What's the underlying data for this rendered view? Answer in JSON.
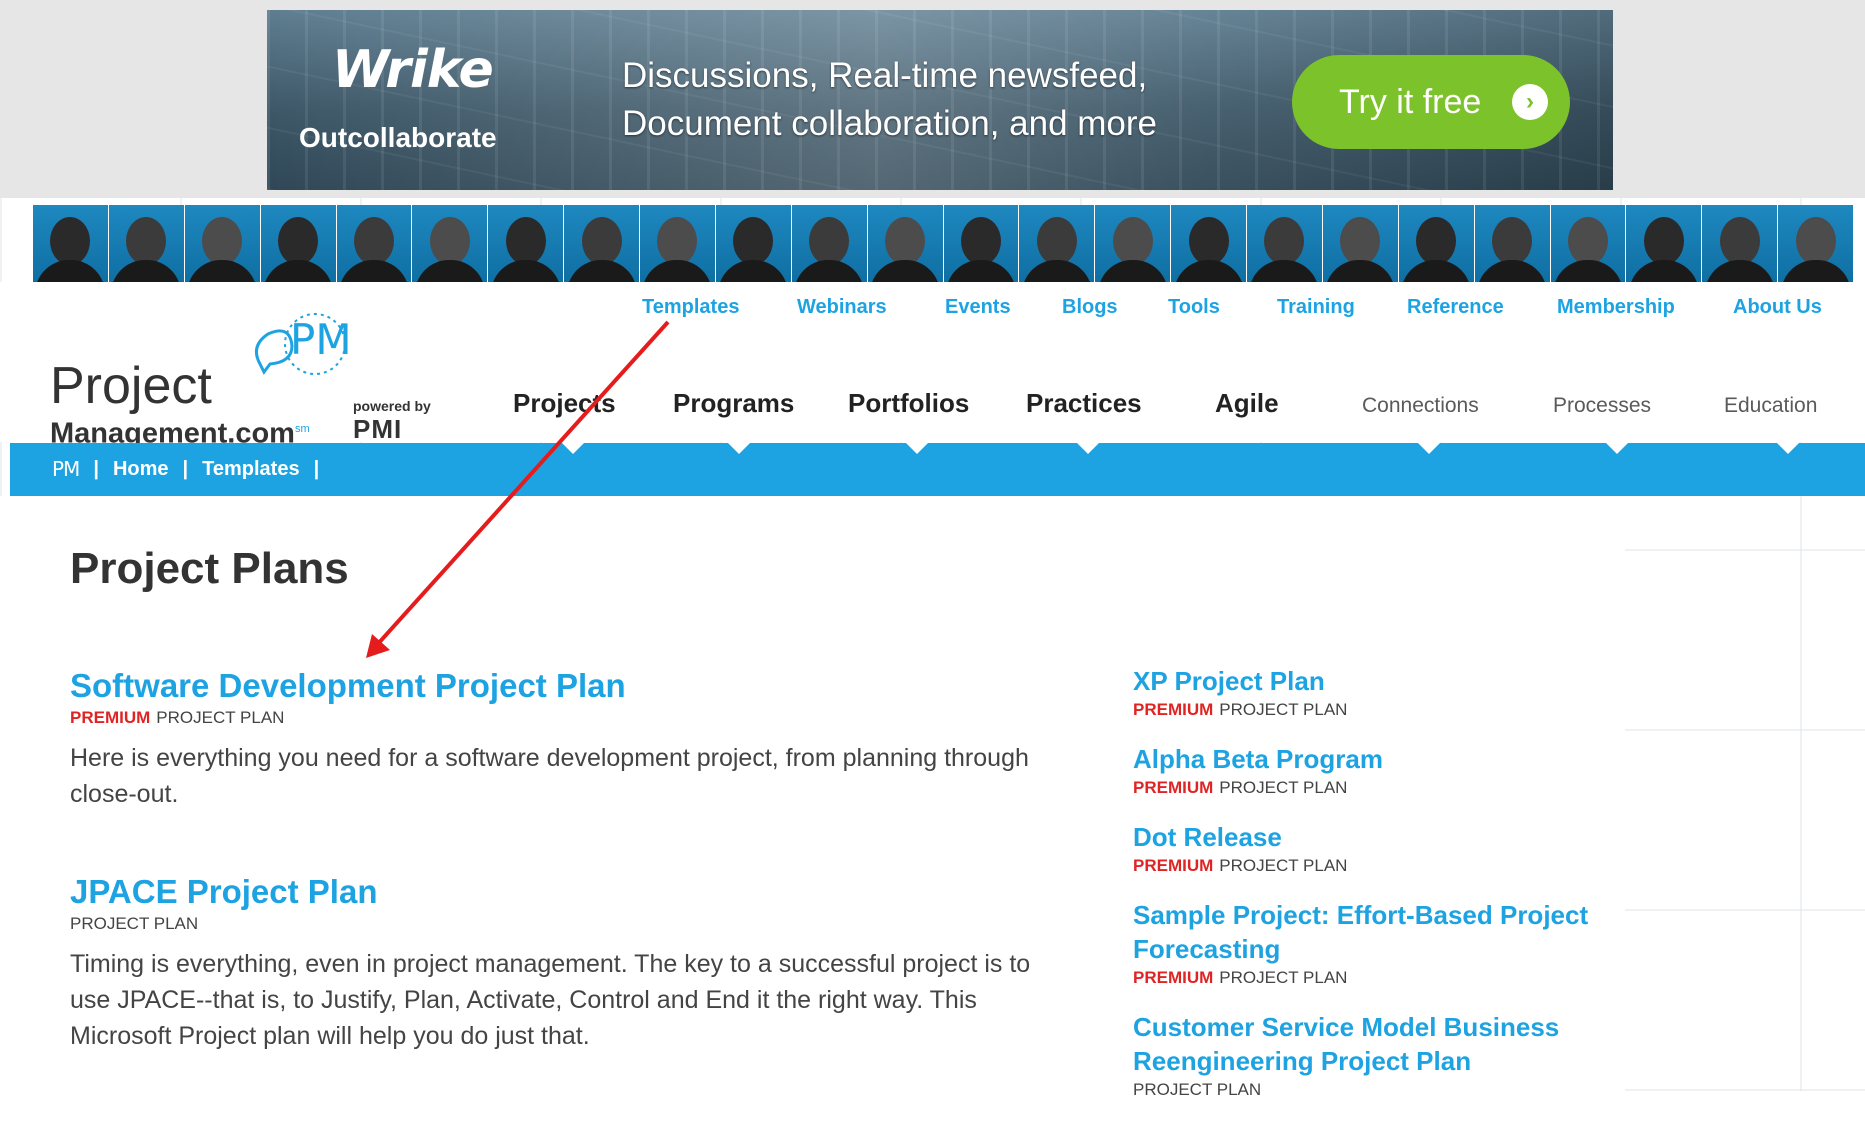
{
  "ad": {
    "brand": "Wrike",
    "tagline": "Outcollaborate",
    "copy_line1": "Discussions, Real-time newsfeed,",
    "copy_line2": "Document collaboration, and more",
    "cta": "Try it free",
    "cta_arrow": "›"
  },
  "logo": {
    "pm": "PM",
    "project": "Project",
    "management": "Management.com",
    "sm": "sm",
    "powered_by": "powered by",
    "pmi": "PMI"
  },
  "topnav": [
    "Templates",
    "Webinars",
    "Events",
    "Blogs",
    "Tools",
    "Training",
    "Reference",
    "Membership",
    "About Us"
  ],
  "mainnav": [
    "Projects",
    "Programs",
    "Portfolios",
    "Practices",
    "Agile"
  ],
  "subnav": [
    "Connections",
    "Processes",
    "Education"
  ],
  "breadcrumb": {
    "logo": "PM",
    "home": "Home",
    "templates": "Templates",
    "sep": "|"
  },
  "page": {
    "title": "Project Plans"
  },
  "left_items": [
    {
      "title": "Software Development Project Plan",
      "premium": "PREMIUM",
      "type": "PROJECT PLAN",
      "desc": "Here is everything you need for a software development project, from planning through close-out."
    },
    {
      "title": "JPACE Project Plan",
      "premium": "",
      "type": "PROJECT PLAN",
      "desc": "Timing is everything, even in project management. The key to a successful project is to use JPACE--that is, to Justify, Plan, Activate, Control and End it the right way. This Microsoft Project plan will help you do just that."
    }
  ],
  "right_items": [
    {
      "title": "XP Project Plan",
      "premium": "PREMIUM",
      "type": "PROJECT PLAN"
    },
    {
      "title": "Alpha Beta Program",
      "premium": "PREMIUM",
      "type": "PROJECT PLAN"
    },
    {
      "title": "Dot Release",
      "premium": "PREMIUM",
      "type": "PROJECT PLAN"
    },
    {
      "title": "Sample Project: Effort-Based Project Forecasting",
      "premium": "PREMIUM",
      "type": "PROJECT PLAN"
    },
    {
      "title": "Customer Service Model Business Reengineering Project Plan",
      "premium": "",
      "type": "PROJECT PLAN"
    }
  ],
  "colors": {
    "accent_blue": "#1ea3e2",
    "premium_red": "#e02424",
    "cta_green": "#7cc22a",
    "annotation_red": "#e51c1c"
  },
  "annotation": {
    "type": "red-arrow",
    "from": "Templates",
    "to": "Software Development Project Plan"
  }
}
